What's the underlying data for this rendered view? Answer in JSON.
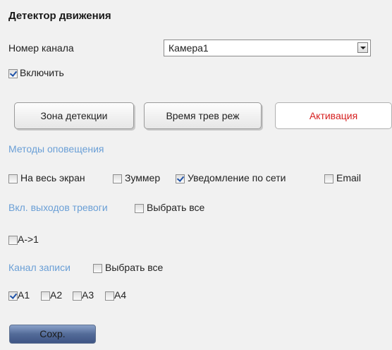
{
  "page": {
    "title": "Детектор движения"
  },
  "channel": {
    "label": "Номер канала",
    "selected": "Камера1"
  },
  "enable": {
    "label": "Включить",
    "checked": true
  },
  "tabs": [
    {
      "label": "Зона детекции",
      "active": false
    },
    {
      "label": "Время трев реж",
      "active": false
    },
    {
      "label": "Активация",
      "active": true
    }
  ],
  "notify": {
    "heading": "Методы оповещения",
    "options": [
      {
        "label": "На весь экран",
        "checked": false
      },
      {
        "label": "Зуммер",
        "checked": false
      },
      {
        "label": "Уведомление по сети",
        "checked": true
      },
      {
        "label": "Email",
        "checked": false
      }
    ]
  },
  "alarm_out": {
    "heading": "Вкл. выходов тревоги",
    "select_all": "Выбрать все",
    "items": [
      {
        "label": "A->1",
        "checked": false
      }
    ]
  },
  "record": {
    "heading": "Канал записи",
    "select_all": "Выбрать все",
    "items": [
      {
        "label": "A1",
        "checked": true
      },
      {
        "label": "A2",
        "checked": false
      },
      {
        "label": "A3",
        "checked": false
      },
      {
        "label": "A4",
        "checked": false
      }
    ]
  },
  "save_label": "Сохр.",
  "colors": {
    "section_heading": "#6a9fd6",
    "active_tab_text": "#d62020",
    "save_button": "#536b98"
  }
}
